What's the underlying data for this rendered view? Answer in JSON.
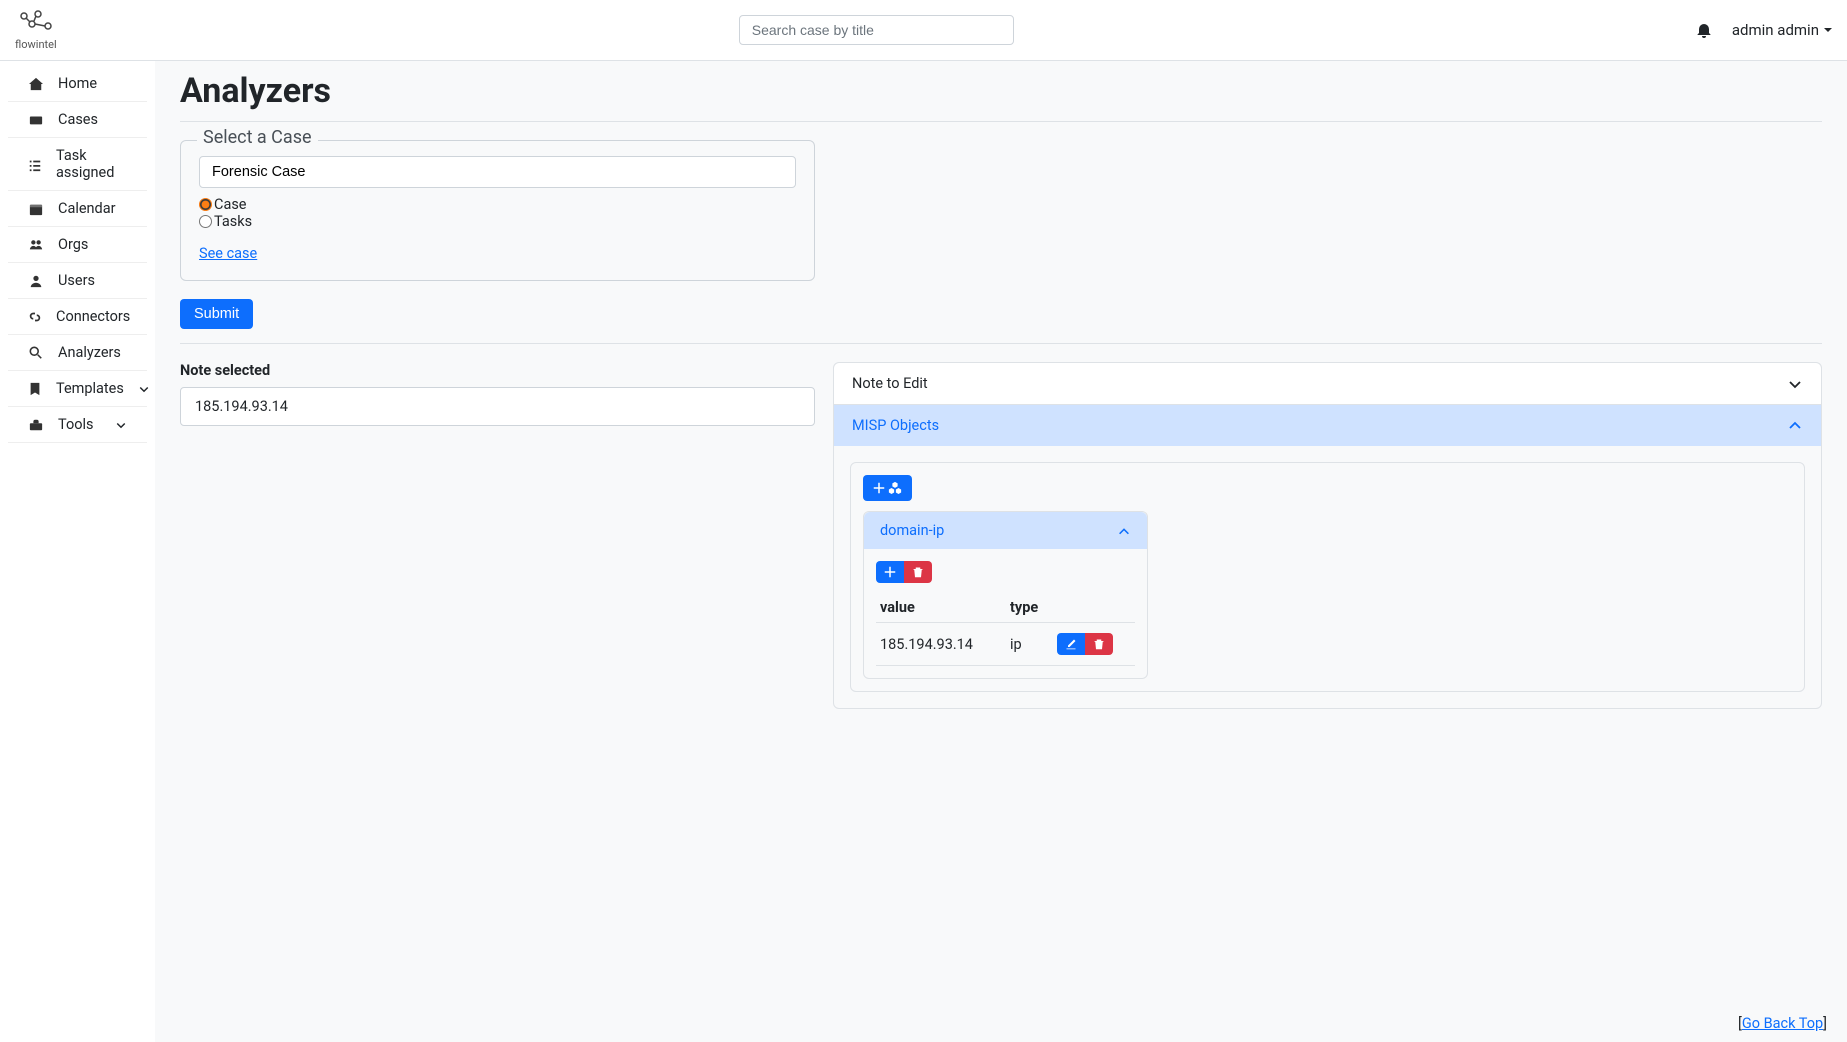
{
  "header": {
    "logo_text": "flowintel",
    "search_placeholder": "Search case by title",
    "user_name": "admin admin"
  },
  "sidebar": {
    "items": [
      {
        "label": "Home"
      },
      {
        "label": "Cases"
      },
      {
        "label": "Task assigned"
      },
      {
        "label": "Calendar"
      },
      {
        "label": "Orgs"
      },
      {
        "label": "Users"
      },
      {
        "label": "Connectors"
      },
      {
        "label": "Analyzers"
      },
      {
        "label": "Templates"
      },
      {
        "label": "Tools"
      }
    ]
  },
  "page": {
    "title": "Analyzers",
    "fieldset_legend": "Select a Case",
    "case_value": "Forensic Case",
    "radio_case_label": "Case",
    "radio_tasks_label": "Tasks",
    "see_case_label": "See case",
    "submit_label": "Submit",
    "note_selected_label": "Note selected",
    "note_value": "185.194.93.14",
    "note_to_edit_label": "Note to Edit",
    "misp_objects_label": "MISP Objects",
    "object_name": "domain-ip",
    "table": {
      "col_value": "value",
      "col_type": "type",
      "row_value": "185.194.93.14",
      "row_type": "ip"
    },
    "go_back_top": "Go Back Top"
  }
}
